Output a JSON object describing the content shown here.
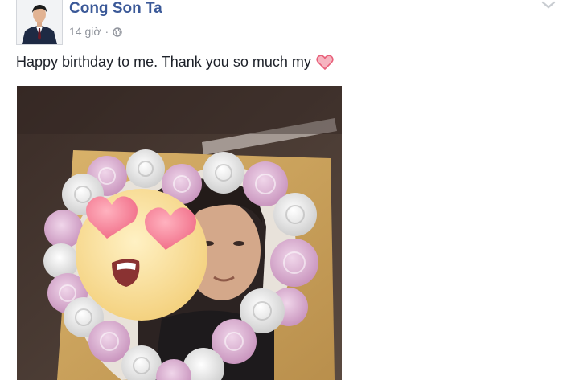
{
  "post": {
    "author_name": "Cong Son Ta",
    "timestamp": "14 giờ",
    "separator": "·",
    "privacy_icon": "globe-icon",
    "menu_icon": "chevron-down-icon",
    "text": "Happy birthday to me. Thank you so much my",
    "text_emoji": "heart-icon",
    "accent_color": "#3b5998",
    "meta_color": "#90949c",
    "heart_color": "#f4a3b3"
  }
}
